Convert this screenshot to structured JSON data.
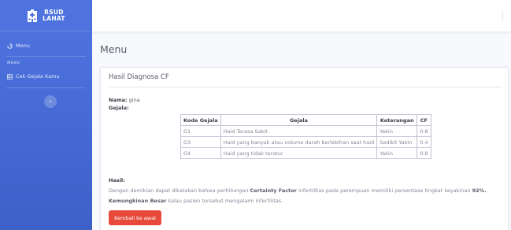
{
  "brand": {
    "line1": "RSUD",
    "line2": "LAHAT"
  },
  "sidebar": {
    "menu_label": "Menu",
    "section_heading": "MENU",
    "item_label": "Cek Gejala Kamu",
    "toggle_icon": "chevron-left-icon"
  },
  "page": {
    "title": "Menu"
  },
  "card": {
    "title": "Hasil Diagnosa CF",
    "nama_label": "Nama:",
    "nama_value": "gina",
    "gejala_label": "Gejala:",
    "table": {
      "headers": [
        "Kode Gejala",
        "Gejala",
        "Keterangan",
        "CF"
      ],
      "rows": [
        [
          "G1",
          "Haid Terasa Sakit",
          "Yakin",
          "0.8"
        ],
        [
          "G3",
          "Haid yang banyak atau volume darah berlebihan saat haid",
          "Sedikit Yakin",
          "0.4"
        ],
        [
          "G4",
          "Haid yang tidak teratur",
          "Yakin",
          "0.8"
        ]
      ]
    },
    "hasil_label": "Hasil:",
    "hasil_part1": "Dengan demikian dapat dikatakan bahwa perhitungan ",
    "hasil_bold1": "Certainty Factor",
    "hasil_part2": " infertilitas pada perempuan memiliki persentase tingkat keyakinan ",
    "hasil_bold2": "92%.",
    "hasil_bold3": "Kemungkinan Besar",
    "hasil_part3": " kalau pasien tersebut mengalami infertilitas.",
    "button_label": "Kembali ke awal"
  },
  "colors": {
    "sidebar": "#4e73df",
    "button": "#e74a3b",
    "text": "#858796"
  }
}
